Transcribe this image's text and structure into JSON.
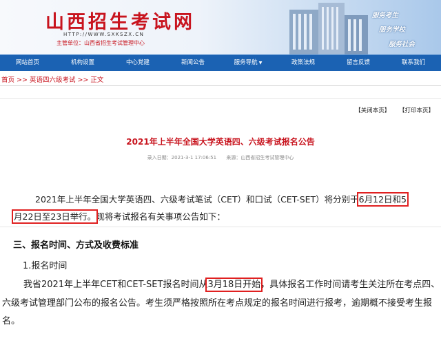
{
  "header": {
    "title": "山西招生考试网",
    "url": "HTTP://WWW.SXKSZX.CN",
    "sponsor": "主管单位：山西省招生考试管理中心",
    "slogans": [
      "服务考生",
      "服务学校",
      "服务社会"
    ]
  },
  "nav": {
    "items": [
      "网站首页",
      "机构设置",
      "中心党建",
      "新闻公告",
      "服务导航",
      "政策法规",
      "留言反馈",
      "联系我们"
    ],
    "dropdown_caret": "▼"
  },
  "breadcrumb": {
    "items": [
      "首页",
      "英语四六级考试",
      "正文"
    ],
    "separator": ">>"
  },
  "article": {
    "actions": [
      "【关闭本页】",
      "【打印本页】"
    ],
    "title": "2021年上半年全国大学英语四、六级考试报名公告",
    "meta": {
      "date": "录入日期：2021-3-1 17:06:51",
      "source": "来源：山西省招生考试管理中心"
    },
    "para1": {
      "part1": "2021年上半年全国大学英语四、六级考试笔试（CET）和口试（CET-SET）将分别于",
      "hl1": "6月12日和5",
      "hl2": "月22日至23日举行。",
      "part2": "现将考试报名有关事项公告如下："
    }
  },
  "section3": {
    "title": "三、报名时间、方式及收费标准",
    "subtitle": "1.报名时间",
    "para": {
      "part1": "我省2021年上半年CET和CET-SET报名时间从",
      "hl": "3月18日开始",
      "part2": "，具体报名工作时间请考生关注所在考点四、六级考试管理部门公布的报名公告。考生须严格按照所在考点规定的报名时间进行报考，逾期概不接受考生报名。"
    }
  },
  "colors": {
    "brand_red": "#c8141e",
    "nav_blue": "#1b62b3",
    "highlight_box": "#e02020"
  }
}
